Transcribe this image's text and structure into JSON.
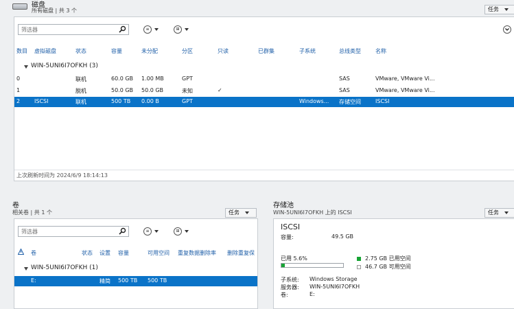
{
  "disks": {
    "title": "磁盘",
    "subtitle": "所有磁盘 | 共 3 个",
    "tasks_label": "任务",
    "filter_placeholder": "筛选器",
    "columns": [
      "数目",
      "虚拟磁盘",
      "状态",
      "容量",
      "未分配",
      "分区",
      "只读",
      "已群集",
      "子系统",
      "总线类型",
      "名称"
    ],
    "group": "WIN-5UNI6I7OFKH (3)",
    "rows": [
      {
        "num": "0",
        "vdisk": "",
        "status": "联机",
        "capacity": "60.0 GB",
        "unalloc": "1.00 MB",
        "part": "GPT",
        "ro": "",
        "cluster": "",
        "subsys": "",
        "bus": "SAS",
        "name": "VMware, VMware Vi..."
      },
      {
        "num": "1",
        "vdisk": "",
        "status": "脱机",
        "capacity": "50.0 GB",
        "unalloc": "50.0 GB",
        "part": "未知",
        "ro": "✓",
        "cluster": "",
        "subsys": "",
        "bus": "SAS",
        "name": "VMware, VMware Vi..."
      },
      {
        "num": "2",
        "vdisk": "ISCSI",
        "status": "联机",
        "capacity": "500 TB",
        "unalloc": "0.00 B",
        "part": "GPT",
        "ro": "",
        "cluster": "",
        "subsys": "Windows...",
        "bus": "存储空间",
        "name": "ISCSI"
      }
    ],
    "last_refresh": "上次刷新时间为 2024/6/9 18:14:13"
  },
  "volumes": {
    "title": "卷",
    "subtitle": "相关卷 | 共 1 个",
    "tasks_label": "任务",
    "filter_placeholder": "筛选器",
    "columns": [
      "卷",
      "状态",
      "设置",
      "容量",
      "可用空间",
      "重复数据删除率",
      "删除重复保"
    ],
    "group": "WIN-5UNI6I7OFKH (1)",
    "rows": [
      {
        "vol": "E:",
        "status": "",
        "setting": "精简",
        "capacity": "500 TB",
        "free": "500 TB",
        "dedup": "",
        "dedup2": ""
      }
    ]
  },
  "pool": {
    "title": "存储池",
    "subtitle": "WIN-5UNI6I7OFKH 上的 ISCSI",
    "tasks_label": "任务",
    "name": "ISCSI",
    "capacity_label": "容量:",
    "capacity_value": "49.5 GB",
    "used_label": "已用 5.6%",
    "used_fraction": 0.056,
    "used_space": "2.75 GB 已用空间",
    "free_space": "46.7 GB 可用空间",
    "subsystem_label": "子系统:",
    "subsystem_value": "Windows Storage",
    "server_label": "服务器:",
    "server_value": "WIN-5UNI6I7OFKH",
    "volume_label": "卷:",
    "volume_value": "E:",
    "used_color": "#17a434"
  },
  "colors": {
    "accent": "#0a73c8",
    "header": "#1f5fa8"
  }
}
